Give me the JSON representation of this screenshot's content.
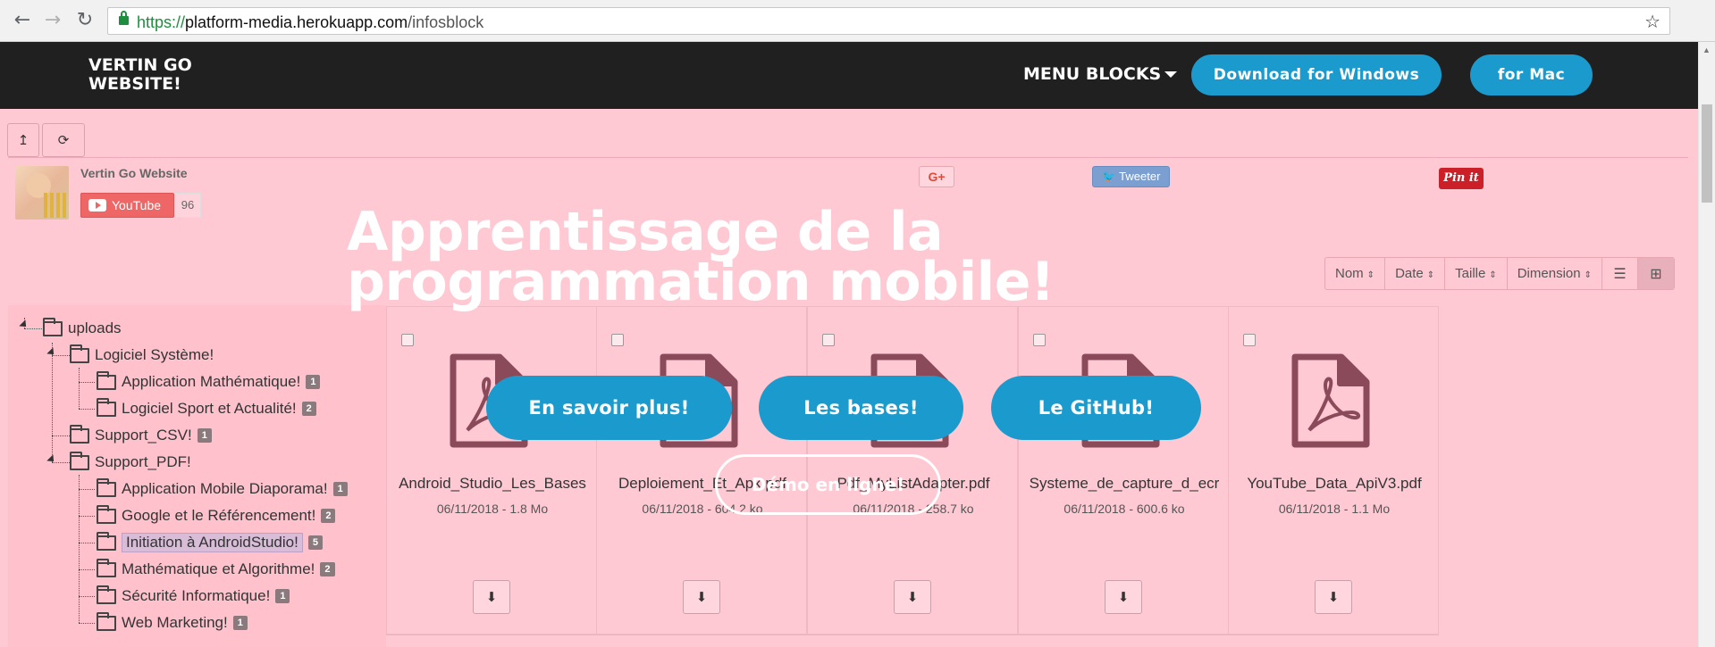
{
  "browser": {
    "url_scheme": "https://",
    "url_host": "platform-media.herokuapp.com",
    "url_path": "/infosblock",
    "back_icon": "arrow-left-icon",
    "forward_icon": "arrow-right-icon",
    "reload_icon": "reload-icon",
    "star_icon": "star-icon"
  },
  "navbar": {
    "brand": "VERTIN GO WEBSITE!",
    "menu_label": "MENU BLOCKS",
    "download_windows": "Download for Windows",
    "download_mac": "for Mac"
  },
  "toolbar": {
    "up_icon": "↥",
    "refresh_icon": "⟳"
  },
  "profile": {
    "channel_name": "Vertin Go Website",
    "youtube_label": "YouTube",
    "subscriber_count": "96"
  },
  "social": {
    "google_plus": "G+",
    "tweet": "Tweeter",
    "pinterest": "Pin it"
  },
  "hero": {
    "title": "Apprentissage de la programmation mobile!",
    "btn_more": "En savoir plus!",
    "btn_basics": "Les bases!",
    "btn_github": "Le GitHub!",
    "btn_demo": "Démo en ligne!"
  },
  "sort": {
    "name": "Nom",
    "date": "Date",
    "size": "Taille",
    "dimension": "Dimension",
    "list_icon": "☰",
    "grid_icon": "⊞"
  },
  "tree": {
    "root": "uploads",
    "items": [
      {
        "label": "Logiciel Système!",
        "badge": ""
      },
      {
        "label": "Application Mathématique!",
        "badge": "1"
      },
      {
        "label": "Logiciel Sport et Actualité!",
        "badge": "2"
      },
      {
        "label": "Support_CSV!",
        "badge": "1"
      },
      {
        "label": "Support_PDF!",
        "badge": ""
      },
      {
        "label": "Application Mobile Diaporama!",
        "badge": "1"
      },
      {
        "label": "Google et le Référencement!",
        "badge": "2"
      },
      {
        "label": "Initiation à AndroidStudio!",
        "badge": "5"
      },
      {
        "label": "Mathématique et Algorithme!",
        "badge": "2"
      },
      {
        "label": "Sécurité Informatique!",
        "badge": "1"
      },
      {
        "label": "Web Marketing!",
        "badge": "1"
      }
    ]
  },
  "files": [
    {
      "name": "Android_Studio_Les_Bases",
      "meta": "06/11/2018 - 1.8 Mo"
    },
    {
      "name": "Deploiement_Et_Apk.pdf",
      "meta": "06/11/2018 - 604.2 ko"
    },
    {
      "name": "Pdf_MyListAdapter.pdf",
      "meta": "06/11/2018 - 258.7 ko"
    },
    {
      "name": "Systeme_de_capture_d_ecr",
      "meta": "06/11/2018 - 600.6 ko"
    },
    {
      "name": "YouTube_Data_ApiV3.pdf",
      "meta": "06/11/2018 - 1.1 Mo"
    }
  ],
  "download_icon": "⬇",
  "colors": {
    "page_bg": "#ffc9d4",
    "accent": "#1b9bcd",
    "navbar_bg": "#202020",
    "pdf_icon": "#8a4a5a"
  }
}
